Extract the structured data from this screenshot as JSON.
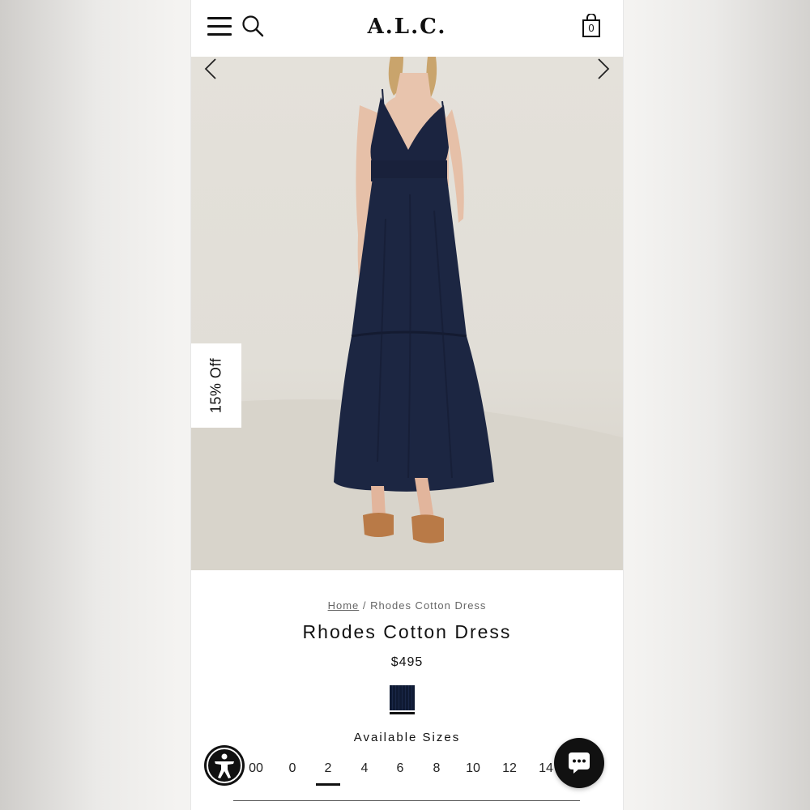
{
  "header": {
    "brand": "A.L.C.",
    "cart_count": "0",
    "icons": [
      "menu-icon",
      "search-icon",
      "shopping-bag-icon"
    ]
  },
  "gallery": {
    "badge": "15% Off",
    "icons": [
      "chevron-left-icon",
      "chevron-right-icon"
    ]
  },
  "breadcrumb": {
    "home": "Home",
    "separator": "/",
    "current": "Rhodes Cotton Dress"
  },
  "product": {
    "title": "Rhodes Cotton Dress",
    "price": "$495",
    "swatch_color": "#0f1a33"
  },
  "sizes": {
    "label": "Available Sizes",
    "options": [
      "00",
      "0",
      "2",
      "4",
      "6",
      "8",
      "10",
      "12",
      "14"
    ],
    "selected": "2"
  },
  "widgets": {
    "accessibility_icon": "accessibility-icon",
    "chat_icon": "chat-icon"
  }
}
